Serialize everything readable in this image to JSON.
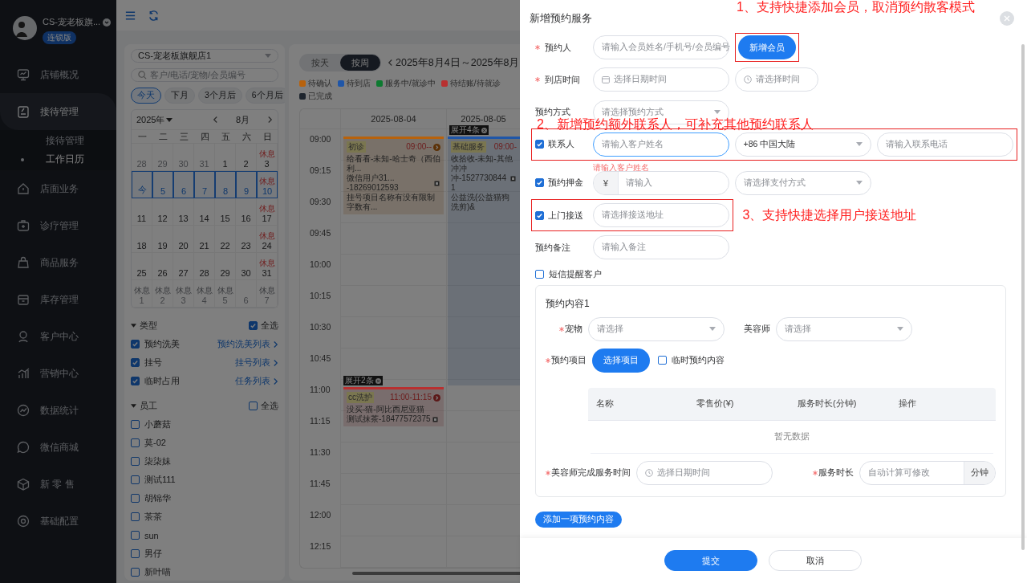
{
  "sidebar": {
    "store_name": "CS-宠老板旗...",
    "badge": "连锁版",
    "items": [
      {
        "label": "店铺概况",
        "selected": false
      },
      {
        "label": "接待管理",
        "selected": true,
        "expanded": true,
        "children": [
          {
            "label": "接待管理",
            "selected": false
          },
          {
            "label": "工作日历",
            "selected": true
          }
        ]
      },
      {
        "label": "店面业务",
        "selected": false
      },
      {
        "label": "诊疗管理",
        "selected": false
      },
      {
        "label": "商品服务",
        "selected": false
      },
      {
        "label": "库存管理",
        "selected": false
      },
      {
        "label": "客户中心",
        "selected": false
      },
      {
        "label": "营销中心",
        "selected": false
      },
      {
        "label": "数据统计",
        "selected": false
      },
      {
        "label": "微信商城",
        "selected": false
      },
      {
        "label": "新 零 售",
        "selected": false
      },
      {
        "label": "基础配置",
        "selected": false
      }
    ]
  },
  "filters": {
    "store": "CS-宠老板旗舰店1",
    "search": {
      "placeholder": "客户/电话/宠物/会员编号"
    },
    "quick": [
      {
        "label": "今天",
        "selected": true
      },
      {
        "label": "下月",
        "selected": false
      },
      {
        "label": "3个月后",
        "selected": false
      },
      {
        "label": "6个月后",
        "selected": false
      }
    ],
    "mini_calendar": {
      "year": "2025年",
      "month": "8月",
      "weekdays": [
        "一",
        "二",
        "三",
        "四",
        "五",
        "六",
        "日"
      ],
      "weeks": [
        [
          {
            "label": "28",
            "muted": true,
            "selected": false
          },
          {
            "label": "29",
            "muted": true,
            "selected": false
          },
          {
            "label": "30",
            "muted": true,
            "selected": false
          },
          {
            "label": "31",
            "muted": true,
            "selected": false
          },
          {
            "label": "1",
            "muted": false,
            "selected": false
          },
          {
            "label": "2",
            "muted": false,
            "selected": false
          },
          {
            "label": "3",
            "muted": false,
            "selected": false,
            "note": "休息"
          }
        ],
        [
          {
            "label": "今",
            "muted": false,
            "selected": true
          },
          {
            "label": "5",
            "muted": false,
            "selected": true
          },
          {
            "label": "6",
            "muted": false,
            "selected": true
          },
          {
            "label": "7",
            "muted": false,
            "selected": true
          },
          {
            "label": "8",
            "muted": false,
            "selected": true
          },
          {
            "label": "9",
            "muted": false,
            "selected": true
          },
          {
            "label": "10",
            "muted": false,
            "selected": true,
            "note": "休息"
          }
        ],
        [
          {
            "label": "11",
            "muted": false,
            "selected": false
          },
          {
            "label": "12",
            "muted": false,
            "selected": false
          },
          {
            "label": "13",
            "muted": false,
            "selected": false
          },
          {
            "label": "14",
            "muted": false,
            "selected": false
          },
          {
            "label": "15",
            "muted": false,
            "selected": false
          },
          {
            "label": "16",
            "muted": false,
            "selected": false
          },
          {
            "label": "17",
            "muted": false,
            "selected": false,
            "note": "休息"
          }
        ],
        [
          {
            "label": "18",
            "muted": false,
            "selected": false
          },
          {
            "label": "19",
            "muted": false,
            "selected": false
          },
          {
            "label": "20",
            "muted": false,
            "selected": false
          },
          {
            "label": "21",
            "muted": false,
            "selected": false
          },
          {
            "label": "22",
            "muted": false,
            "selected": false
          },
          {
            "label": "23",
            "muted": false,
            "selected": false
          },
          {
            "label": "24",
            "muted": false,
            "selected": false,
            "note": "休息"
          }
        ],
        [
          {
            "label": "25",
            "muted": false,
            "selected": false
          },
          {
            "label": "26",
            "muted": false,
            "selected": false
          },
          {
            "label": "27",
            "muted": false,
            "selected": false
          },
          {
            "label": "28",
            "muted": false,
            "selected": false
          },
          {
            "label": "29",
            "muted": false,
            "selected": false
          },
          {
            "label": "30",
            "muted": false,
            "selected": false
          },
          {
            "label": "31",
            "muted": false,
            "selected": false,
            "note": "休息"
          }
        ],
        [
          {
            "label": "1",
            "muted": true,
            "selected": false,
            "note": "休息"
          },
          {
            "label": "2",
            "muted": true,
            "selected": false,
            "note": "休息"
          },
          {
            "label": "3",
            "muted": true,
            "selected": false,
            "note": "休息"
          },
          {
            "label": "4",
            "muted": true,
            "selected": false,
            "note": "休息"
          },
          {
            "label": "5",
            "muted": true,
            "selected": false,
            "note": "休息"
          },
          {
            "label": "6",
            "muted": true,
            "selected": false
          },
          {
            "label": "7",
            "muted": true,
            "selected": false,
            "note": "休息"
          }
        ]
      ]
    },
    "sections": [
      {
        "title": "类型",
        "expanded": true,
        "select_all": {
          "label": "全选",
          "checked": true
        },
        "items": [
          {
            "label": "预约洗美",
            "checked": true,
            "link": "预约洗美列表"
          },
          {
            "label": "挂号",
            "checked": true,
            "link": "挂号列表"
          },
          {
            "label": "临时占用",
            "checked": true,
            "link": "任务列表"
          }
        ]
      },
      {
        "title": "员工",
        "expanded": true,
        "select_all": {
          "label": "全选",
          "checked": false
        },
        "items": [
          {
            "label": "小蘑菇",
            "checked": false
          },
          {
            "label": "莫-02",
            "checked": false
          },
          {
            "label": "柒柒妹",
            "checked": false
          },
          {
            "label": "测试111",
            "checked": false
          },
          {
            "label": "胡锦华",
            "checked": false
          },
          {
            "label": "茶茶",
            "checked": false
          },
          {
            "label": "sun",
            "checked": false
          },
          {
            "label": "男仔",
            "checked": false
          },
          {
            "label": "新叶喵",
            "checked": false
          }
        ]
      }
    ]
  },
  "calendar": {
    "views": [
      {
        "label": "按天",
        "selected": false
      },
      {
        "label": "按周",
        "selected": true
      }
    ],
    "range": "2025年8月4日～2025年8月",
    "legend": [
      {
        "label": "待确认",
        "color": "#b8620c"
      },
      {
        "label": "待到店",
        "color": "#1f56a8"
      },
      {
        "label": "服务中/就诊中",
        "color": "#0d7a30"
      },
      {
        "label": "待结账/待就诊",
        "color": "#b83030"
      },
      {
        "label": "已完成",
        "color": "#1e252e"
      }
    ],
    "days": [
      "2025-08-04",
      "2025-08-05"
    ],
    "rows": [
      {
        "time": "09:00",
        "cells": [
          {
            "kind": "card",
            "color": "#b8620c",
            "tag": "初诊",
            "time": "09:00--",
            "arrow": true,
            "lines": [
              {
                "text": "给看看-未知-哈士奇（西伯利...",
                "copy": false
              },
              {
                "text": "微信用户31...  -18269012593",
                "copy": true
              },
              {
                "text": "挂号项目名称有没有限制字数有...",
                "copy": false
              }
            ]
          },
          {
            "kind": "block",
            "color": "#1f56a8",
            "expand": "展开4条",
            "tag": "基础服务",
            "time": "09:00-",
            "arrow": false,
            "lines": [
              {
                "text": "收拾收-未知-其他",
                "copy": false
              },
              {
                "text": "冲冲冲-15277308441",
                "copy": true
              },
              {
                "text": "公益洗(公益猫狗洗剪)&",
                "copy": false
              }
            ]
          }
        ]
      },
      {
        "time": "09:15"
      },
      {
        "time": "09:30"
      },
      {
        "time": "09:45"
      },
      {
        "time": "10:00"
      },
      {
        "time": "10:15"
      },
      {
        "time": "10:30"
      },
      {
        "time": "10:45"
      },
      {
        "time": "11:00",
        "cells": [
          {
            "kind": "card",
            "color": "#b83030",
            "expand": "展开2条",
            "tag": "cc洗护",
            "time": "11:00-11:15",
            "arrow": true,
            "lines": [
              {
                "text": "没买-猫-阿比西尼亚猫",
                "copy": false
              },
              {
                "text": "测试抹茶-18477572375",
                "copy": true
              }
            ]
          },
          null
        ]
      },
      {
        "time": "11:15"
      },
      {
        "time": "11:30"
      },
      {
        "time": "11:45"
      },
      {
        "time": "12:00"
      },
      {
        "time": "12:15"
      }
    ]
  },
  "drawer": {
    "title": "新增预约服务",
    "rows": [
      {
        "kind": "plain",
        "label": "预约人",
        "required": true,
        "highlighted": false,
        "fields": [
          {
            "kind": "select",
            "placeholder": "请输入会员姓名/手机号/会员编号"
          }
        ],
        "button": {
          "label": "新增会员",
          "highlighted": true,
          "annotation": "1、支持快捷添加会员，取消预约散客模式"
        }
      },
      {
        "kind": "plain",
        "label": "到店时间",
        "required": true,
        "highlighted": false,
        "fields": [
          {
            "kind": "date",
            "placeholder": "选择日期时间"
          },
          {
            "kind": "time",
            "placeholder": "请选择时间"
          }
        ]
      },
      {
        "kind": "plain",
        "label": "预约方式",
        "required": false,
        "highlighted": false,
        "fields": [
          {
            "kind": "select",
            "placeholder": "请选择预约方式"
          }
        ]
      },
      {
        "kind": "annotation",
        "text": "2、新增预约额外联系人，可补充其他预约联系人"
      },
      {
        "kind": "check",
        "label": "联系人",
        "checked": true,
        "required": false,
        "highlighted": true,
        "fields": [
          {
            "kind": "input",
            "placeholder": "请输入客户姓名",
            "focused": true,
            "error": "请输入客户姓名"
          },
          {
            "kind": "select",
            "value": "+86 中国大陆"
          },
          {
            "kind": "input",
            "placeholder": "请输入联系电话"
          }
        ]
      },
      {
        "kind": "check",
        "label": "预约押金",
        "checked": true,
        "required": false,
        "highlighted": false,
        "fields": [
          {
            "kind": "prefix",
            "prefix": "¥",
            "placeholder": "请输入"
          },
          {
            "kind": "select",
            "placeholder": "请选择支付方式"
          }
        ]
      },
      {
        "kind": "check",
        "label": "上门接送",
        "checked": true,
        "required": false,
        "highlighted": true,
        "annotation": "3、支持快捷选择用户接送地址",
        "fields": [
          {
            "kind": "input",
            "placeholder": "请选择接送地址"
          }
        ]
      },
      {
        "kind": "plain",
        "label": "预约备注",
        "required": false,
        "highlighted": false,
        "fields": [
          {
            "kind": "input",
            "placeholder": "请输入备注"
          }
        ]
      },
      {
        "kind": "option",
        "label": "短信提醒客户",
        "checked": false
      }
    ],
    "content": {
      "title": "预约内容1",
      "pet_row": [
        {
          "label": "宠物",
          "required": true,
          "field": {
            "kind": "select",
            "placeholder": "请选择"
          }
        },
        {
          "label": "美容师",
          "required": false,
          "field": {
            "kind": "select",
            "placeholder": "请选择"
          }
        }
      ],
      "items_row": {
        "label": "预约项目",
        "required": true,
        "button": "选择项目",
        "option": {
          "label": "临时预约内容",
          "checked": false
        }
      },
      "table": {
        "columns": [
          "名称",
          "零售价(¥)",
          "服务时长(分钟)",
          "操作"
        ],
        "empty": "暂无数据"
      },
      "time_row": [
        {
          "label": "美容师完成服务时间",
          "required": true,
          "field": {
            "kind": "datetime",
            "placeholder": "选择日期时间"
          }
        },
        {
          "label": "服务时长",
          "required": true,
          "field": {
            "kind": "suffix",
            "placeholder": "自动计算可修改",
            "suffix": "分钟"
          }
        }
      ]
    },
    "add_button": "添加一项预约内容",
    "footer": [
      {
        "label": "提交",
        "kind": "primary"
      },
      {
        "label": "取消",
        "kind": "default"
      }
    ]
  }
}
